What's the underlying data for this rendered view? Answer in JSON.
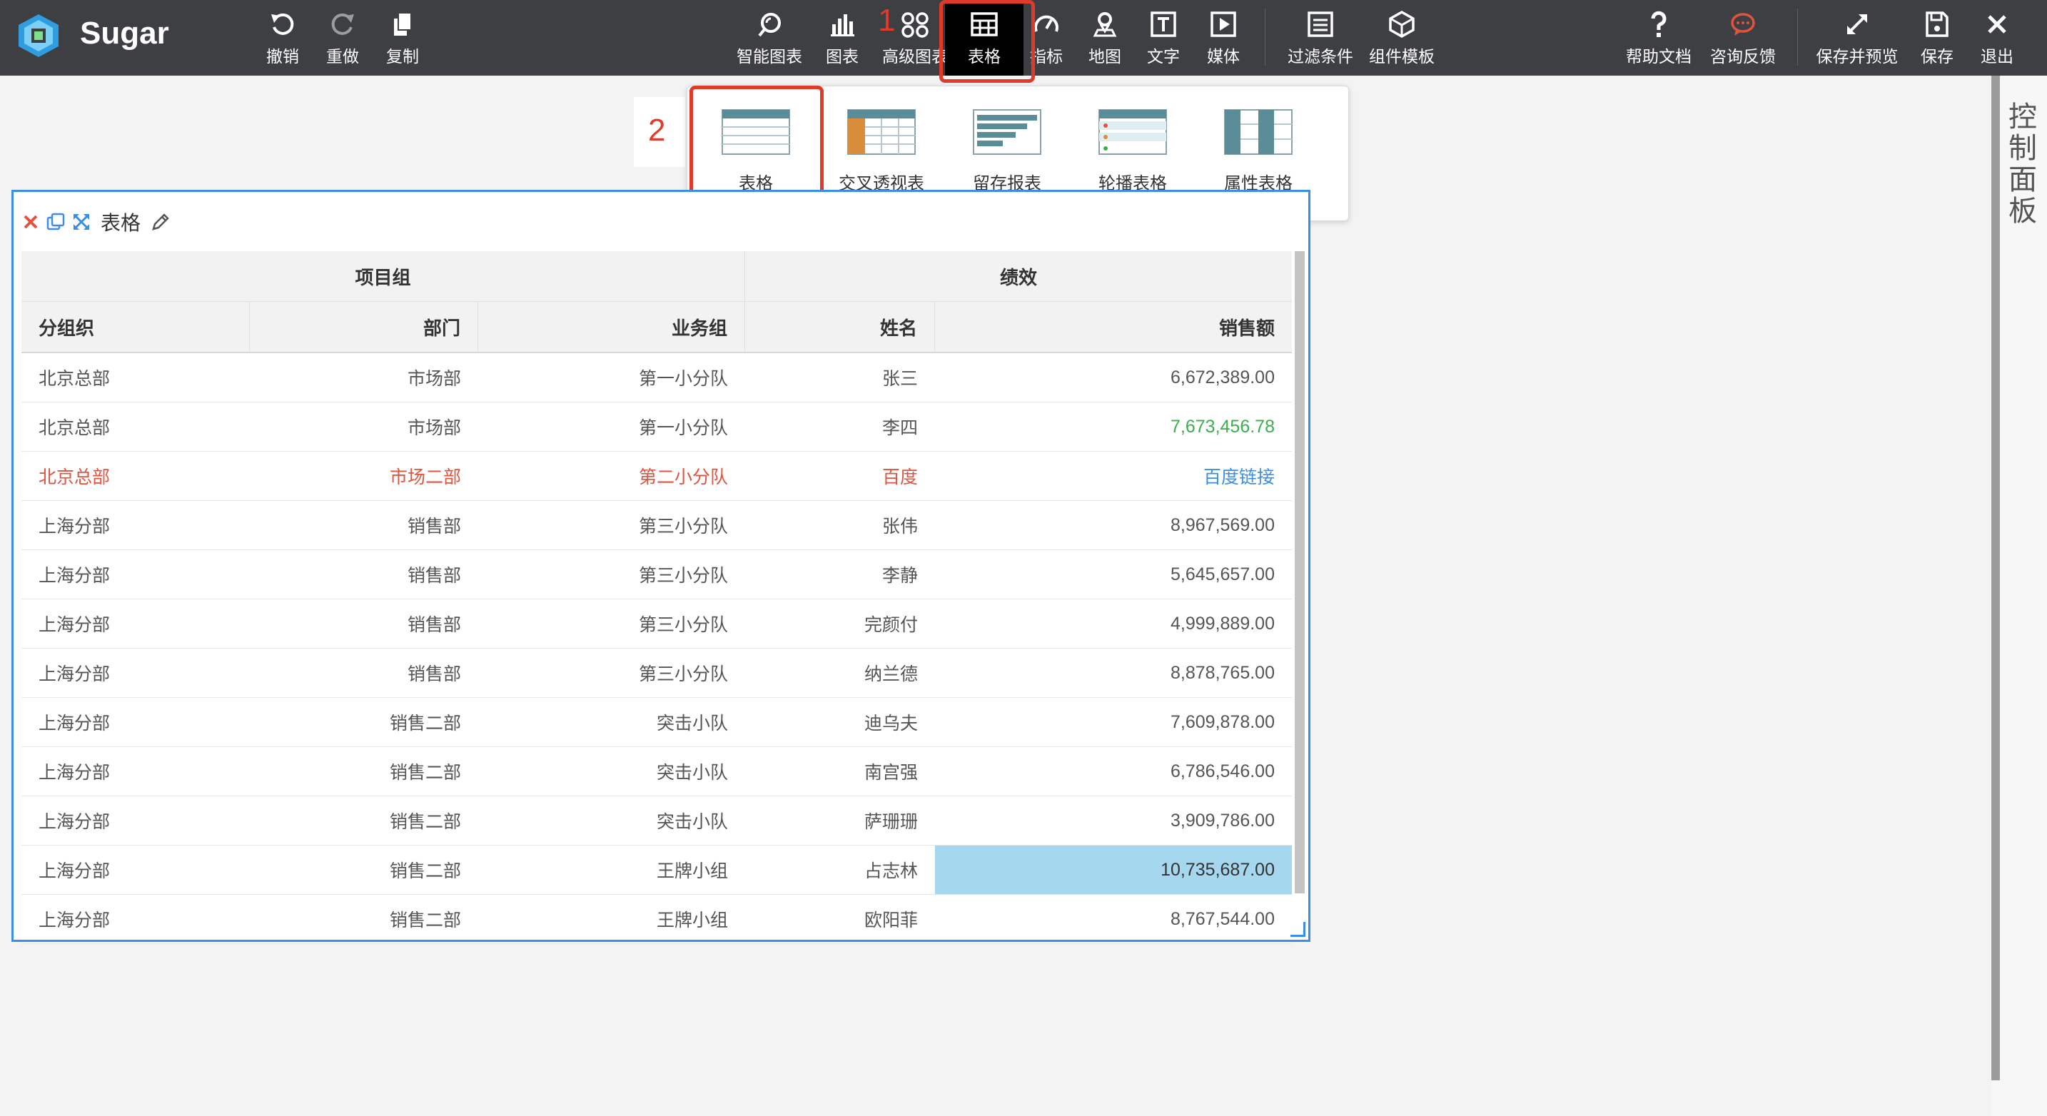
{
  "app": {
    "name": "Sugar"
  },
  "toolbar": {
    "undo": "撤销",
    "redo": "重做",
    "copy": "复制",
    "smart_chart": "智能图表",
    "chart": "图表",
    "advanced_chart": "高级图表",
    "table": "表格",
    "indicator": "指标",
    "map": "地图",
    "text": "文字",
    "media": "媒体",
    "filter": "过滤条件",
    "component_template": "组件模板",
    "help": "帮助文档",
    "feedback": "咨询反馈",
    "save_preview": "保存并预览",
    "save": "保存",
    "exit": "退出"
  },
  "annotations": {
    "step1": "1",
    "step2": "2"
  },
  "dropdown": {
    "items": [
      {
        "label": "表格"
      },
      {
        "label": "交叉透视表"
      },
      {
        "label": "留存报表"
      },
      {
        "label": "轮播表格"
      },
      {
        "label": "属性表格"
      }
    ]
  },
  "widget": {
    "title": "表格"
  },
  "table": {
    "group_headers": [
      "项目组",
      "绩效"
    ],
    "columns": [
      "分组织",
      "部门",
      "业务组",
      "姓名",
      "销售额"
    ],
    "rows": [
      [
        "北京总部",
        "市场部",
        "第一小分队",
        "张三",
        "6,672,389.00"
      ],
      [
        "北京总部",
        "市场部",
        "第一小分队",
        "李四",
        "7,673,456.78"
      ],
      [
        "北京总部",
        "市场二部",
        "第二小分队",
        "百度",
        "百度链接"
      ],
      [
        "上海分部",
        "销售部",
        "第三小分队",
        "张伟",
        "8,967,569.00"
      ],
      [
        "上海分部",
        "销售部",
        "第三小分队",
        "李静",
        "5,645,657.00"
      ],
      [
        "上海分部",
        "销售部",
        "第三小分队",
        "完颜付",
        "4,999,889.00"
      ],
      [
        "上海分部",
        "销售部",
        "第三小分队",
        "纳兰德",
        "8,878,765.00"
      ],
      [
        "上海分部",
        "销售二部",
        "突击小队",
        "迪乌夫",
        "7,609,878.00"
      ],
      [
        "上海分部",
        "销售二部",
        "突击小队",
        "南宫强",
        "6,786,546.00"
      ],
      [
        "上海分部",
        "销售二部",
        "突击小队",
        "萨珊珊",
        "3,909,786.00"
      ],
      [
        "上海分部",
        "销售二部",
        "王牌小组",
        "占志林",
        "10,735,687.00"
      ],
      [
        "上海分部",
        "销售二部",
        "王牌小组",
        "欧阳菲",
        "8,767,544.00"
      ]
    ],
    "styles": {
      "green_text": "#3cae4a",
      "red_text": "#e0533f",
      "link_text": "#3b8ee8",
      "highlight_bg": "#a5d8ee"
    }
  },
  "panel": {
    "label": "控制面板"
  }
}
